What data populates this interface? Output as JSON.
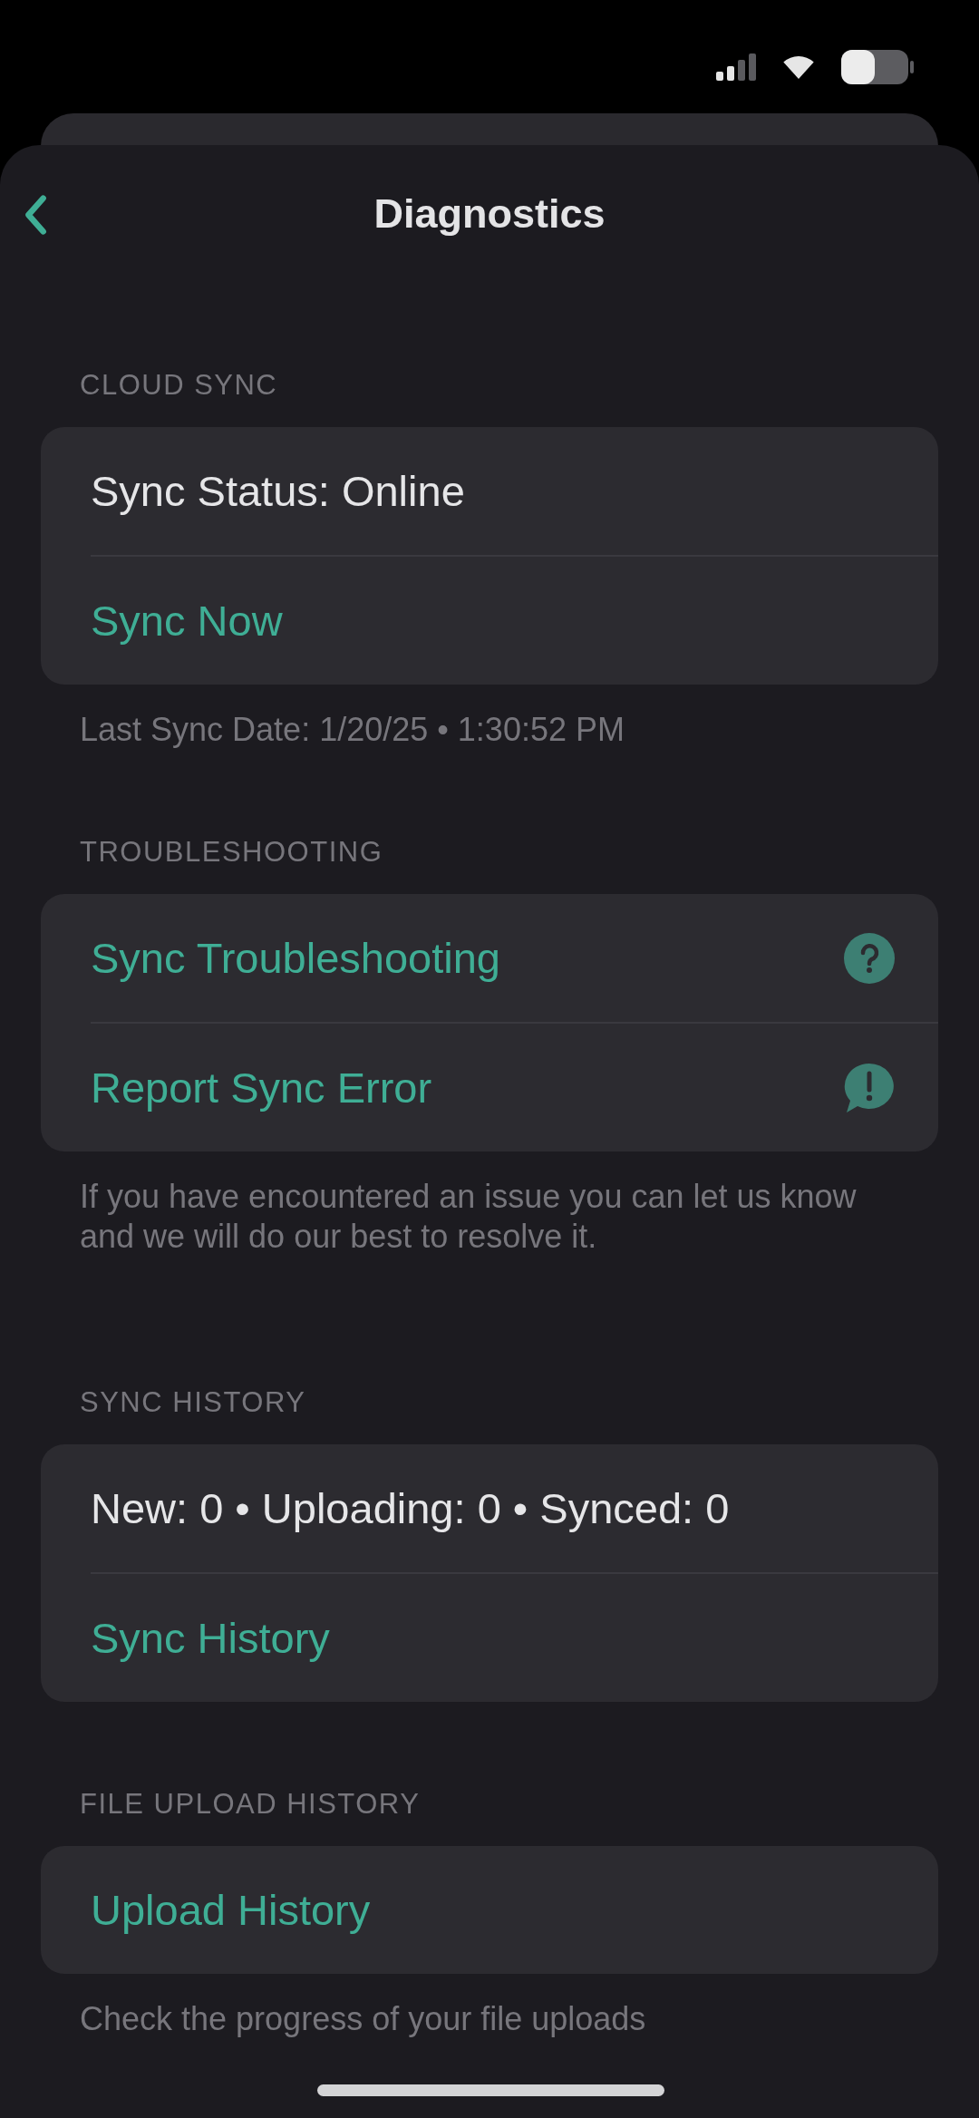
{
  "header": {
    "title": "Diagnostics"
  },
  "sections": [
    {
      "heading": "CLOUD SYNC",
      "rows": [
        {
          "kind": "text",
          "text": "Sync Status: Online"
        },
        {
          "kind": "link",
          "text": "Sync Now"
        }
      ],
      "footer": "Last Sync Date: 1/20/25 • 1:30:52 PM"
    },
    {
      "heading": "TROUBLESHOOTING",
      "rows": [
        {
          "kind": "help",
          "text": "Sync Troubleshooting"
        },
        {
          "kind": "report",
          "text": "Report Sync Error"
        }
      ],
      "footer": "If you have encountered an issue you can let us know and we will do our best to resolve it."
    },
    {
      "heading": "SYNC HISTORY",
      "rows": [
        {
          "kind": "text",
          "text": "New: 0 • Uploading: 0 • Synced: 0"
        },
        {
          "kind": "link",
          "text": "Sync History"
        }
      ]
    },
    {
      "heading": "FILE UPLOAD HISTORY",
      "rows": [
        {
          "kind": "link",
          "text": "Upload History"
        }
      ],
      "footer": "Check the progress of your file uploads"
    }
  ]
}
